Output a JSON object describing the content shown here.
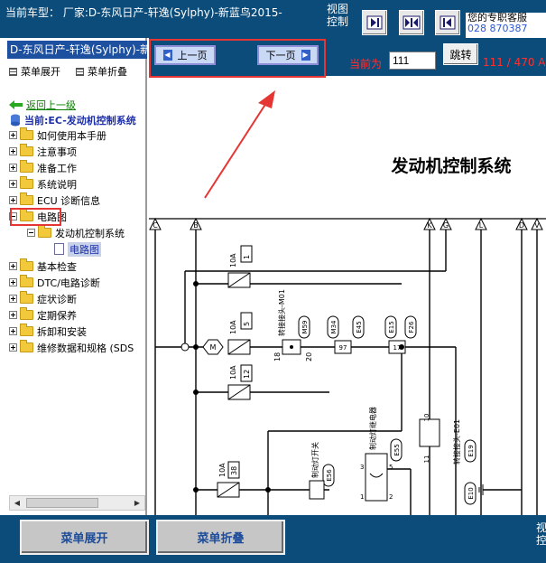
{
  "header": {
    "vehicle": "当前车型：  厂家:D-东风日产-轩逸(Sylphy)-新蓝鸟2015-",
    "view_control": "视图控制",
    "contact_line1": "您的专职客服",
    "contact_line2": "028 870387"
  },
  "sidebar": {
    "title": "D-东风日产-轩逸(Sylphy)-新",
    "menu_expand": "菜单展开",
    "menu_collapse": "菜单折叠",
    "back_link": "返回上一级",
    "current": "当前:EC-发动机控制系统",
    "items": [
      "如何使用本手册",
      "注意事项",
      "准备工作",
      "系统说明",
      "ECU 诊断信息",
      "电路图",
      "发动机控制系统",
      "电路图",
      "基本检查",
      "DTC/电路诊断",
      "症状诊断",
      "定期保养",
      "拆卸和安装",
      "维修数据和规格 (SDS"
    ]
  },
  "pager": {
    "prev_label": "上一页",
    "next_label": "下一页",
    "page_label": "当前为",
    "page_value": "111",
    "jump_label": "跳转",
    "page_count": "111 / 470 A"
  },
  "diagram": {
    "title": "发动机控制系统",
    "connector_labels": [
      "C",
      "B",
      "K",
      "G",
      "L",
      "D",
      "V"
    ],
    "fuses": [
      {
        "amp": "10A",
        "num": "1"
      },
      {
        "amp": "10A",
        "num": "5"
      },
      {
        "amp": "10A",
        "num": "12"
      },
      {
        "amp": "10A",
        "num": "38"
      }
    ],
    "node_m": "M",
    "joint_m01": "转接接头-M01",
    "joint_e01": "转接接头-E01",
    "codes": [
      "M59",
      "M34",
      "E45",
      "E15",
      "F26",
      "E55",
      "E56",
      "E19",
      "E10"
    ],
    "pins": [
      "18",
      "20",
      "97",
      "17",
      "10",
      "11",
      "3",
      "5",
      "1",
      "2",
      "54"
    ],
    "brake_switch": "制动灯开关",
    "brake_relay": "制动灯继电器"
  },
  "footer": {
    "expand": "菜单展开",
    "collapse": "菜单折叠",
    "view": "视控"
  },
  "colors": {
    "frame_blue": "#0b4c7a",
    "annotation_red": "#e53535"
  }
}
